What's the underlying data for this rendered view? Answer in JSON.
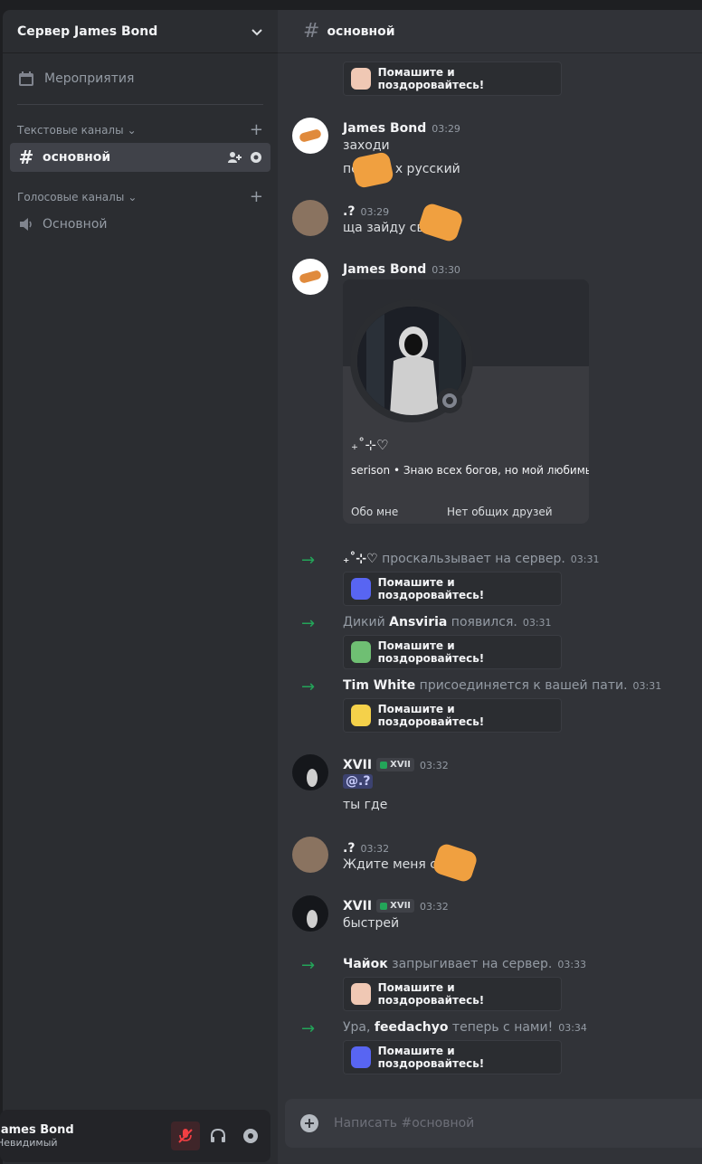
{
  "server": {
    "name": "Сервер James Bond"
  },
  "sidebar": {
    "events_label": "Мероприятия",
    "text_category": "Текстовые каналы",
    "voice_category": "Голосовые каналы",
    "text_channel": "основной",
    "voice_channel": "Основной"
  },
  "user_panel": {
    "name": "James Bond",
    "status": "Невидимый"
  },
  "channel": {
    "name": "основной"
  },
  "wave_label": "Помашите и поздоровайтесь!",
  "messages": [
    {
      "author": "James Bond",
      "time": "03:29",
      "lines": [
        "заходи",
        "пе         х русский"
      ]
    },
    {
      "author": ".?",
      "time": "03:29",
      "lines": [
        "ща зайду сви"
      ]
    },
    {
      "author": "James Bond",
      "time": "03:30"
    },
    {
      "author": "XVII",
      "tag": "XVII",
      "time": "03:32",
      "mention": "@.?",
      "lines": [
        "ты где"
      ]
    },
    {
      "author": ".?",
      "time": "03:32",
      "lines": [
        "Ждите меня св"
      ]
    },
    {
      "author": "XVII",
      "tag": "XVII",
      "time": "03:32",
      "lines": [
        "быстрей"
      ]
    }
  ],
  "profile_card": {
    "display_name": "₊˚⊹♡",
    "username": "serison",
    "bio": "Знаю всех богов, но мой любимы",
    "about_label": "Обо мне",
    "friends_label": "Нет общих друзей"
  },
  "system_messages": [
    {
      "prefix": "",
      "name": "₊˚⊹♡",
      "suffix": " проскальзывает на сервер.",
      "time": "03:31"
    },
    {
      "prefix": "Дикий ",
      "name": "Ansviria",
      "suffix": " появился.",
      "time": "03:31"
    },
    {
      "prefix": "",
      "name": "Tim White",
      "suffix": " присоединяется к вашей пати.",
      "time": "03:31"
    },
    {
      "prefix": "",
      "name": "Чайок",
      "suffix": " запрыгивает на сервер.",
      "time": "03:33"
    },
    {
      "prefix": "Ура, ",
      "name": "feedachyo",
      "suffix": " теперь с нами!",
      "time": "03:34"
    }
  ],
  "composer": {
    "placeholder": "Написать #основной"
  },
  "colors": {
    "accent_green": "#23a559",
    "background": "#313338",
    "sidebar": "#2b2d31"
  }
}
